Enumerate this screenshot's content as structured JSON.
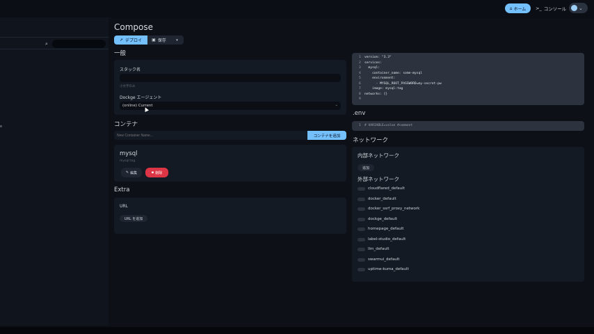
{
  "header": {
    "home_label": "ホーム",
    "console_label": "コンソール"
  },
  "sidebar": {
    "search_placeholder": "",
    "stub_label": "e"
  },
  "page": {
    "title": "Compose",
    "deploy_label": "デプロイ",
    "save_label": "保存"
  },
  "general": {
    "title": "一般",
    "stack_name_label": "スタック名",
    "stack_name_hint": "小文字のみ",
    "agent_label": "Dockge エージェント",
    "agent_value": "(online) Current"
  },
  "containers": {
    "title": "コンテナ",
    "input_placeholder": "New Container Name...",
    "add_label": "コンテナを追加",
    "items": [
      {
        "name": "mysql",
        "image": "mysql:tag",
        "edit_label": "編集",
        "delete_label": "削除"
      }
    ]
  },
  "extra": {
    "title": "Extra",
    "url_label": "URL",
    "add_url_label": "URL を追加"
  },
  "compose_yaml": {
    "lines": [
      {
        "n": "1",
        "t": "version: \"3.3\""
      },
      {
        "n": "2",
        "t": "services:"
      },
      {
        "n": "3",
        "t": "  mysql:"
      },
      {
        "n": "4",
        "t": "    container_name: some-mysql"
      },
      {
        "n": "5",
        "t": "    environment:"
      },
      {
        "n": "6",
        "t": "      - MYSQL_ROOT_PASSWORD=my-secret-pw"
      },
      {
        "n": "7",
        "t": "    image: mysql:tag"
      },
      {
        "n": "8",
        "t": "networks: {}"
      },
      {
        "n": "9",
        "t": ""
      }
    ]
  },
  "env": {
    "title": ".env",
    "line_number": "1",
    "line_text": "# VARIABLE=value #comment"
  },
  "network": {
    "title": "ネットワーク",
    "internal_title": "内部ネットワーク",
    "internal_add_label": "追加",
    "external_title": "外部ネットワーク",
    "external_items": [
      "cloudflared_default",
      "docker_default",
      "docker_ssrf_proxy_network",
      "dockge_default",
      "homepage_default",
      "label-studio_default",
      "llm_default",
      "swarmui_default",
      "uptime-kuma_default"
    ]
  },
  "colors": {
    "accent": "#74c0fc",
    "danger": "#dc3545",
    "background": "#0d1117",
    "card": "#141a23",
    "code_bg": "#2c333e"
  }
}
